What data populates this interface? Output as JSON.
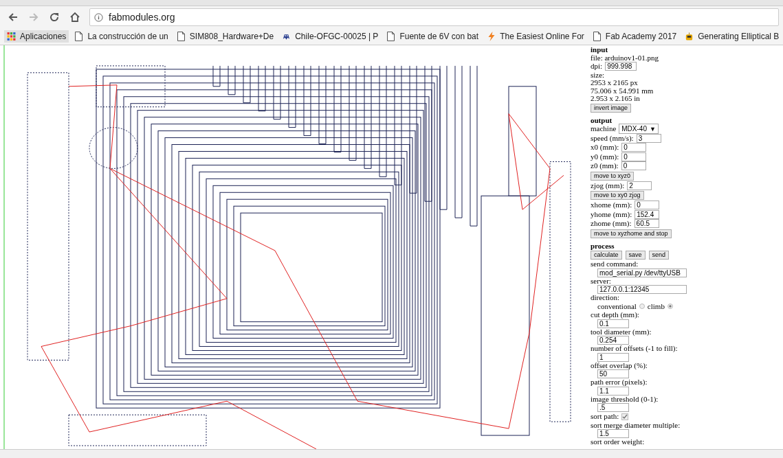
{
  "browser": {
    "url": "fabmodules.org"
  },
  "bookmarks": [
    {
      "kind": "apps",
      "label": "Aplicaciones"
    },
    {
      "kind": "page",
      "label": "La construcción de un"
    },
    {
      "kind": "page",
      "label": "SIM808_Hardware+De"
    },
    {
      "kind": "sprite",
      "label": "Chile-OFGC-00025 | P"
    },
    {
      "kind": "page",
      "label": "Fuente de 6V con bat"
    },
    {
      "kind": "bolt",
      "label": "The Easiest Online For"
    },
    {
      "kind": "page",
      "label": "Fab Academy 2017"
    },
    {
      "kind": "mascot",
      "label": "Generating Elliptical B"
    }
  ],
  "input": {
    "title": "input",
    "file": "file: arduinov1-01.png",
    "dpi_label": "dpi:",
    "dpi": "999.998",
    "size": [
      "size:",
      "2953 x 2165 px",
      "75.006 x 54.991 mm",
      "2.953 x 2.165 in"
    ],
    "button": "invert image"
  },
  "output": {
    "title": "output",
    "machine_label": "machine",
    "machine": "MDX-40",
    "machine_arrow": "▼",
    "rows": [
      {
        "kind": "field",
        "label": "speed (mm/s):",
        "value": "3"
      },
      {
        "kind": "field",
        "label": "x0 (mm):",
        "value": "0"
      },
      {
        "kind": "field",
        "label": "y0 (mm):",
        "value": "0"
      },
      {
        "kind": "field",
        "label": "z0 (mm):",
        "value": "0"
      },
      {
        "kind": "button",
        "label": "move to xyz0"
      },
      {
        "kind": "field",
        "label": "zjog (mm):",
        "value": "2"
      },
      {
        "kind": "button",
        "label": "move to xy0 zjog"
      },
      {
        "kind": "field",
        "label": "xhome (mm):",
        "value": "0"
      },
      {
        "kind": "field",
        "label": "yhome (mm):",
        "value": "152.4"
      },
      {
        "kind": "field",
        "label": "zhome (mm):",
        "value": "60.5"
      },
      {
        "kind": "button",
        "label": "move to xyzhome and stop"
      }
    ]
  },
  "process": {
    "title": "process",
    "buttons": [
      "calculate",
      "save",
      "send"
    ],
    "rows": [
      {
        "kind": "wide",
        "label": "send command:",
        "value": "mod_serial.py /dev/ttyUSB"
      },
      {
        "kind": "wide",
        "label": "server:",
        "value": "127.0.0.1:12345"
      },
      {
        "kind": "radio",
        "label": "direction:",
        "options": [
          {
            "label": "conventional",
            "selected": false
          },
          {
            "label": "climb",
            "selected": true
          }
        ]
      },
      {
        "kind": "stacked",
        "label": "cut depth (mm):",
        "value": "0.1"
      },
      {
        "kind": "stacked",
        "label": "tool diameter (mm):",
        "value": "0.254"
      },
      {
        "kind": "stacked",
        "label": "number of offsets (-1 to fill):",
        "value": "1"
      },
      {
        "kind": "stacked",
        "label": "offset overlap (%):",
        "value": "50"
      },
      {
        "kind": "stacked",
        "label": "path error (pixels):",
        "value": "1.1"
      },
      {
        "kind": "stacked",
        "label": "image threshold (0-1):",
        "value": ".5"
      },
      {
        "kind": "checkbox",
        "label": "sort path:",
        "checked": true
      },
      {
        "kind": "stacked",
        "label": "sort merge diameter multiple:",
        "value": "1.5"
      },
      {
        "kind": "label",
        "label": "sort order weight:"
      }
    ]
  }
}
